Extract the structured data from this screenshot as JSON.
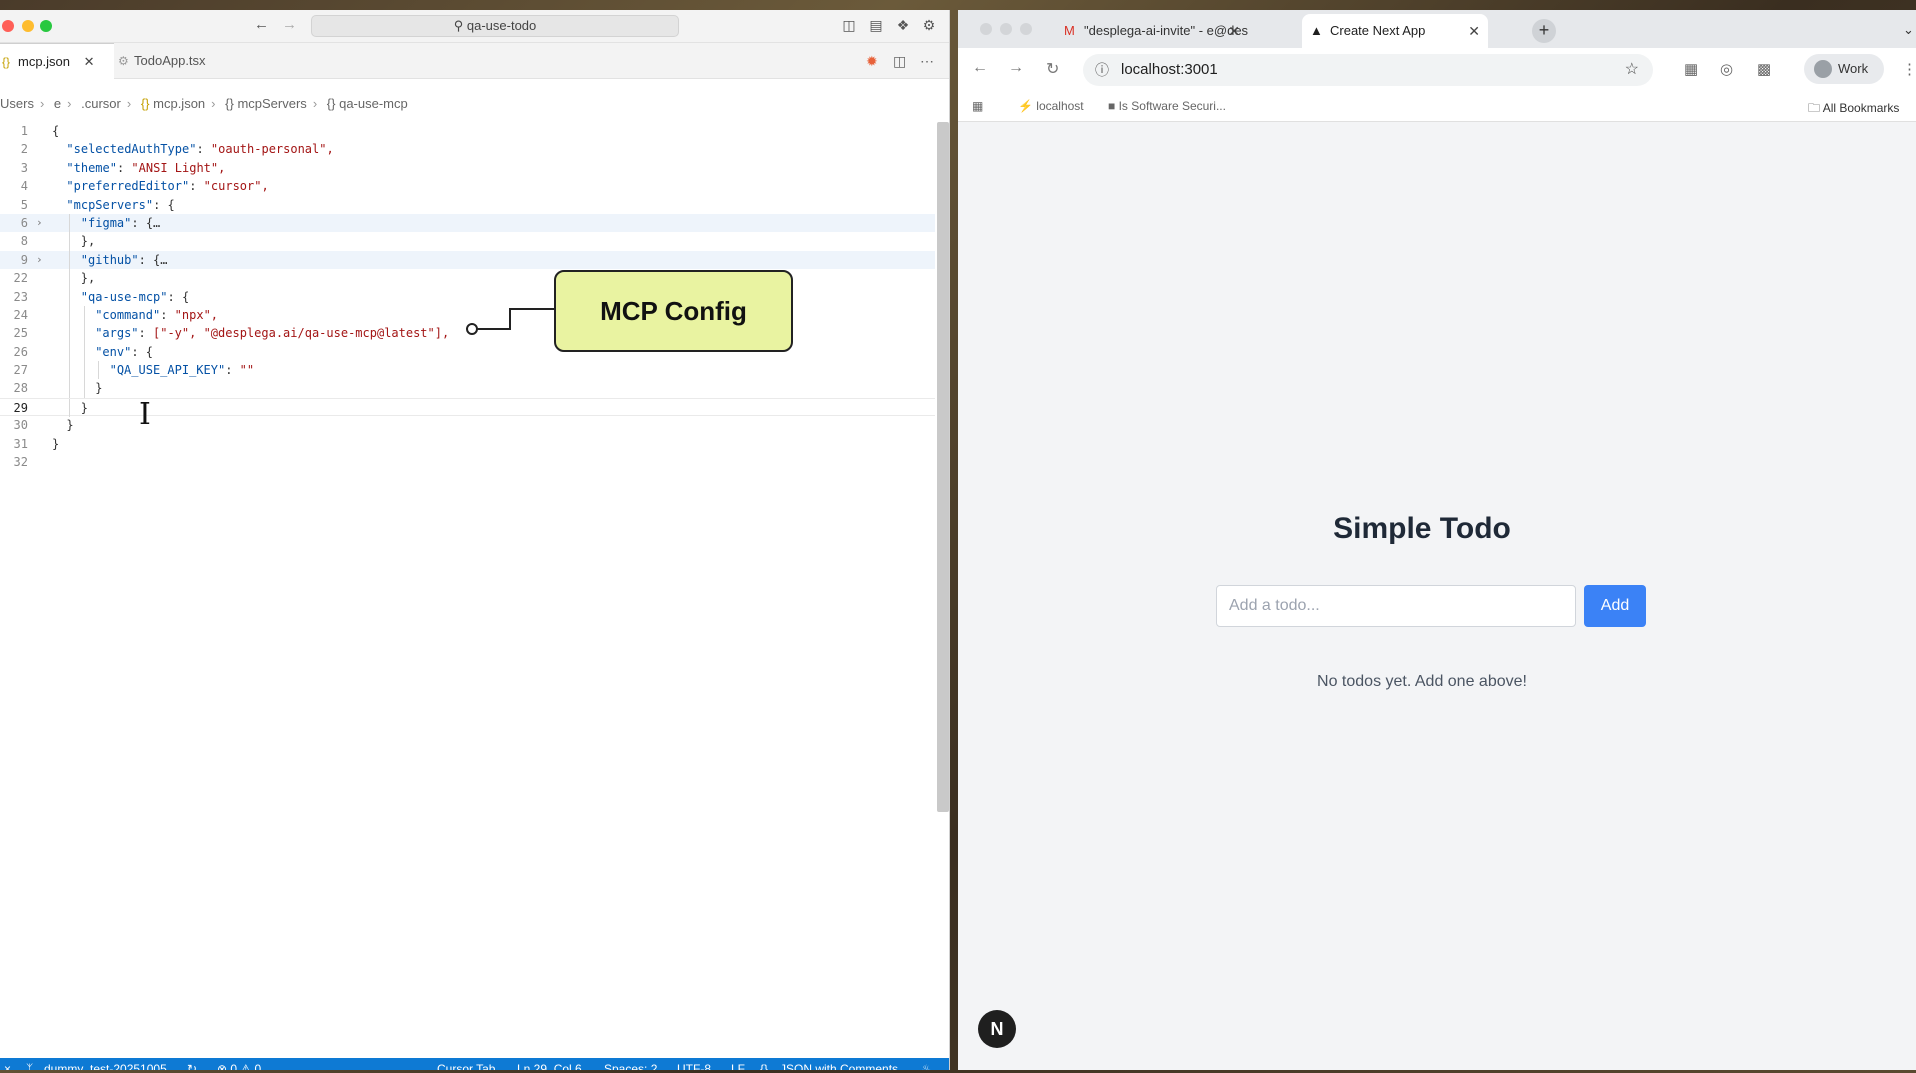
{
  "editor": {
    "search": "qa-use-todo",
    "tabs": [
      {
        "label": "mcp.json",
        "active": true
      },
      {
        "label": "TodoApp.tsx",
        "active": false
      }
    ],
    "breadcrumb": [
      "Users",
      "e",
      ".cursor",
      "mcp.json",
      "mcpServers",
      "qa-use-mcp"
    ],
    "lines": [
      {
        "n": "1",
        "indent": 0,
        "k": "",
        "v": "{"
      },
      {
        "n": "2",
        "indent": 1,
        "k": "\"selectedAuthType\"",
        "v": "\"oauth-personal\","
      },
      {
        "n": "3",
        "indent": 1,
        "k": "\"theme\"",
        "v": "\"ANSI Light\","
      },
      {
        "n": "4",
        "indent": 1,
        "k": "\"preferredEditor\"",
        "v": "\"cursor\","
      },
      {
        "n": "5",
        "indent": 1,
        "k": "\"mcpServers\"",
        "v": "{"
      },
      {
        "n": "6",
        "indent": 2,
        "k": "\"figma\"",
        "v": "{…"
      },
      {
        "n": "8",
        "indent": 2,
        "k": "",
        "v": "},"
      },
      {
        "n": "9",
        "indent": 2,
        "k": "\"github\"",
        "v": "{…"
      },
      {
        "n": "22",
        "indent": 2,
        "k": "",
        "v": "},"
      },
      {
        "n": "23",
        "indent": 2,
        "k": "\"qa-use-mcp\"",
        "v": "{"
      },
      {
        "n": "24",
        "indent": 3,
        "k": "\"command\"",
        "v": "\"npx\","
      },
      {
        "n": "25",
        "indent": 3,
        "k": "\"args\"",
        "v": "[\"-y\", \"@desplega.ai/qa-use-mcp@latest\"],"
      },
      {
        "n": "26",
        "indent": 3,
        "k": "\"env\"",
        "v": "{"
      },
      {
        "n": "27",
        "indent": 4,
        "k": "\"QA_USE_API_KEY\"",
        "v": "\"\""
      },
      {
        "n": "28",
        "indent": 3,
        "k": "",
        "v": "}"
      },
      {
        "n": "29",
        "indent": 2,
        "k": "",
        "v": "}"
      },
      {
        "n": "30",
        "indent": 1,
        "k": "",
        "v": "}"
      },
      {
        "n": "31",
        "indent": 0,
        "k": "",
        "v": "}"
      },
      {
        "n": "32",
        "indent": 0,
        "k": "",
        "v": ""
      }
    ],
    "callout": "MCP Config",
    "status": {
      "branch": "dummy_test-20251005",
      "problems": "⊗ 0 ⚠ 0",
      "cursor_tab": "Cursor Tab",
      "position": "Ln 29, Col 6",
      "spaces": "Spaces: 2",
      "encoding": "UTF-8",
      "eol": "LF",
      "language": "JSON with Comments"
    }
  },
  "browser": {
    "tabs": [
      {
        "label": "\"desplega-ai-invite\" - e@des",
        "active": false
      },
      {
        "label": "Create Next App",
        "active": true
      }
    ],
    "url": "localhost:3001",
    "profile": "Work",
    "bookmarks": [
      "localhost",
      "Is Software Securi...",
      "All Bookmarks"
    ]
  },
  "app": {
    "title": "Simple Todo",
    "input_placeholder": "Add a todo...",
    "add_label": "Add",
    "empty_message": "No todos yet. Add one above!",
    "badge": "N"
  },
  "colors": {
    "accent": "#3b82f6",
    "statusbar": "#0e7ad4",
    "callout": "#e9f3a1"
  }
}
